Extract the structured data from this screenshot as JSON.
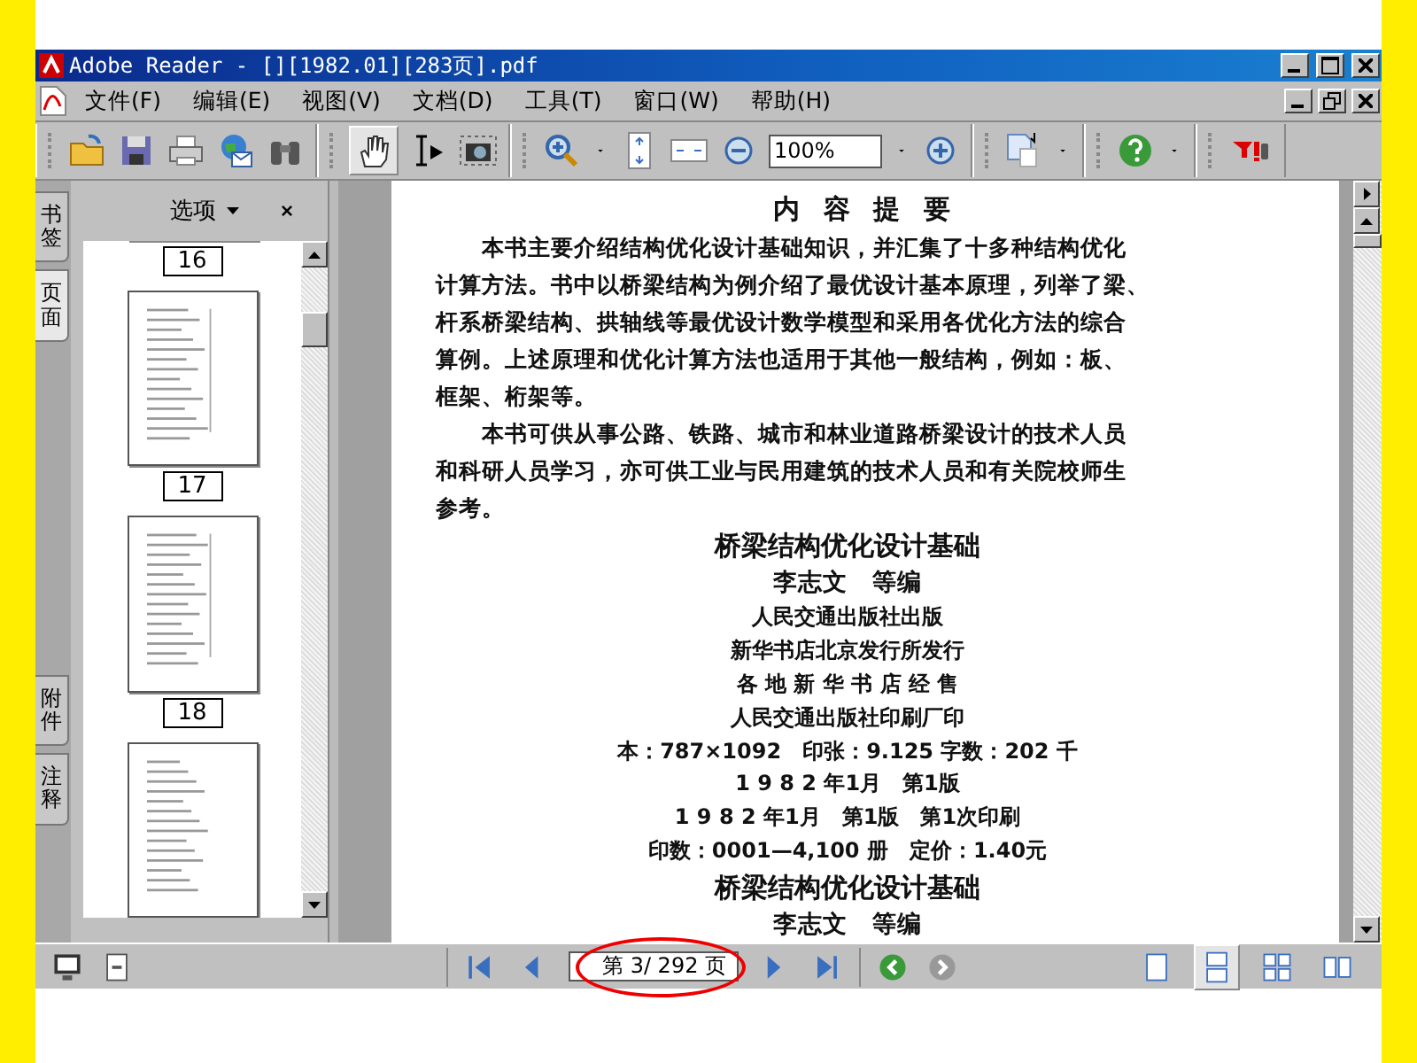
{
  "window": {
    "title": "Adobe Reader - [][1982.01][283页].pdf"
  },
  "menu": [
    {
      "label": "文件(F)"
    },
    {
      "label": "编辑(E)"
    },
    {
      "label": "视图(V)"
    },
    {
      "label": "文档(D)"
    },
    {
      "label": "工具(T)"
    },
    {
      "label": "窗口(W)"
    },
    {
      "label": "帮助(H)"
    }
  ],
  "toolbar": {
    "hand_tool_selected": true,
    "zoom": {
      "value": "100%"
    }
  },
  "sidebar": {
    "tabs": [
      {
        "label": "书签",
        "selected": false
      },
      {
        "label": "页面",
        "selected": true
      },
      {
        "label": "附件",
        "selected": false
      },
      {
        "label": "注释",
        "selected": false
      }
    ],
    "options": "选项",
    "thumbnails": [
      {
        "label": "16"
      },
      {
        "label": "17"
      },
      {
        "label": "18"
      }
    ]
  },
  "document": {
    "blocks": [
      {
        "kind": "heading",
        "text": "内 容 提 要"
      },
      {
        "kind": "indent",
        "text": "本书主要介绍结构优化设计基础知识，并汇集了十多种结构优化"
      },
      {
        "kind": "line",
        "text": "计算方法。书中以桥梁结构为例介绍了最优设计基本原理，列举了梁、"
      },
      {
        "kind": "line",
        "text": "杆系桥梁结构、拱轴线等最优设计数学模型和采用各优化方法的综合"
      },
      {
        "kind": "line",
        "text": "算例。上述原理和优化计算方法也适用于其他一般结构，例如：板、"
      },
      {
        "kind": "line",
        "text": "框架、桁架等。"
      },
      {
        "kind": "indent",
        "text": "本书可供从事公路、铁路、城市和林业道路桥梁设计的技术人员"
      },
      {
        "kind": "line",
        "text": "和科研人员学习，亦可供工业与民用建筑的技术人员和有关院校师生"
      },
      {
        "kind": "line",
        "text": "参考。"
      },
      {
        "kind": "gap"
      },
      {
        "kind": "title",
        "text": "桥梁结构优化设计基础"
      },
      {
        "kind": "author",
        "text": "李志文　等编"
      },
      {
        "kind": "center",
        "text": "人民交通出版社出版"
      },
      {
        "kind": "center",
        "text": "新华书店北京发行所发行"
      },
      {
        "kind": "center",
        "text": "各 地 新 华 书 店 经 售"
      },
      {
        "kind": "center",
        "text": "人民交通出版社印刷厂印"
      },
      {
        "kind": "center",
        "text": "本：787×1092　印张：9.125 字数：202 千"
      },
      {
        "kind": "center",
        "text": "1 9 8 2 年1月　第1版"
      },
      {
        "kind": "center",
        "text": "1 9 8 2 年1月　第1版　第1次印刷"
      },
      {
        "kind": "center",
        "text": "印数：0001—4,100 册　定价：1.40元"
      },
      {
        "kind": "gap"
      },
      {
        "kind": "title",
        "text": "桥梁结构优化设计基础"
      },
      {
        "kind": "author",
        "text": "李志文　等编"
      }
    ]
  },
  "status_bar": {
    "page_field": {
      "value": "第 3/ 292 页"
    },
    "views": [
      {
        "selected": false
      },
      {
        "selected": true
      },
      {
        "selected": false
      },
      {
        "selected": false
      }
    ]
  }
}
